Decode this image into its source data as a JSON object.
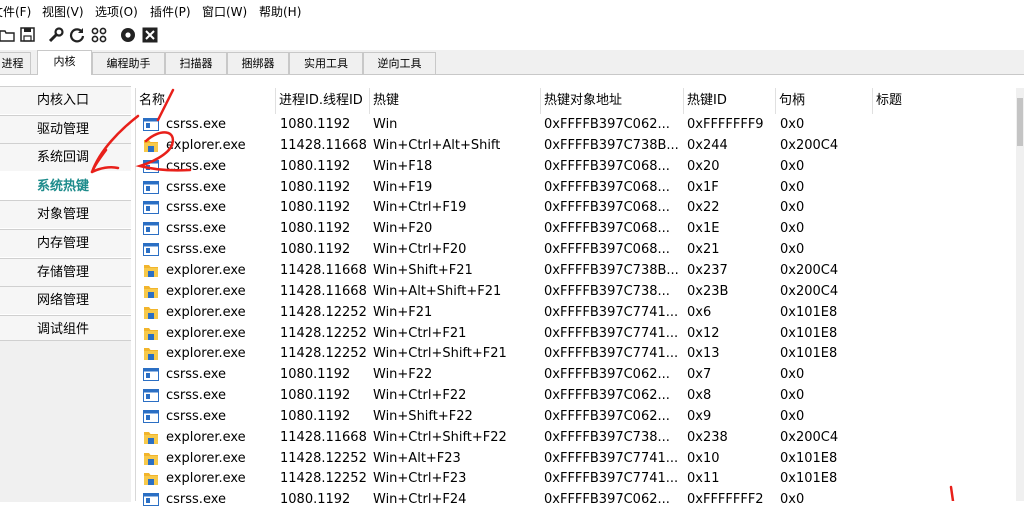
{
  "menu": [
    {
      "label": "文件(F)"
    },
    {
      "label": "视图(V)"
    },
    {
      "label": "选项(O)"
    },
    {
      "label": "插件(P)"
    },
    {
      "label": "窗口(W)"
    },
    {
      "label": "帮助(H)"
    }
  ],
  "toolbar": {
    "icons": [
      "open-folder-icon",
      "save-icon",
      "wrench-icon",
      "refresh-icon",
      "grid-icon",
      "gear-icon",
      "close-icon"
    ]
  },
  "tabs": [
    {
      "label": "进程"
    },
    {
      "label": "内核",
      "active": true
    },
    {
      "label": "编程助手"
    },
    {
      "label": "扫描器"
    },
    {
      "label": "捆绑器"
    },
    {
      "label": "实用工具"
    },
    {
      "label": "逆向工具"
    }
  ],
  "sidebar": {
    "items": [
      {
        "label": "内核入口"
      },
      {
        "label": "驱动管理"
      },
      {
        "label": "系统回调"
      },
      {
        "label": "系统热键",
        "active": true
      },
      {
        "label": "对象管理"
      },
      {
        "label": "内存管理"
      },
      {
        "label": "存储管理"
      },
      {
        "label": "网络管理"
      },
      {
        "label": "调试组件"
      }
    ]
  },
  "table": {
    "columns": [
      "名称",
      "进程ID.线程ID",
      "热键",
      "热键对象地址",
      "热键ID",
      "句柄",
      "标题"
    ],
    "rows": [
      {
        "icon": "csrss",
        "name": "csrss.exe",
        "pid": "1080.1192",
        "hotkey": "Win",
        "addr": "0xFFFFB397C062...",
        "hid": "0xFFFFFFF9",
        "handle": "0x0"
      },
      {
        "icon": "explorer",
        "name": "explorer.exe",
        "pid": "11428.11668",
        "hotkey": "Win+Ctrl+Alt+Shift",
        "addr": "0xFFFFB397C738B...",
        "hid": "0x244",
        "handle": "0x200C4"
      },
      {
        "icon": "csrss",
        "name": "csrss.exe",
        "pid": "1080.1192",
        "hotkey": "Win+F18",
        "addr": "0xFFFFB397C068...",
        "hid": "0x20",
        "handle": "0x0"
      },
      {
        "icon": "csrss",
        "name": "csrss.exe",
        "pid": "1080.1192",
        "hotkey": "Win+F19",
        "addr": "0xFFFFB397C068...",
        "hid": "0x1F",
        "handle": "0x0"
      },
      {
        "icon": "csrss",
        "name": "csrss.exe",
        "pid": "1080.1192",
        "hotkey": "Win+Ctrl+F19",
        "addr": "0xFFFFB397C068...",
        "hid": "0x22",
        "handle": "0x0"
      },
      {
        "icon": "csrss",
        "name": "csrss.exe",
        "pid": "1080.1192",
        "hotkey": "Win+F20",
        "addr": "0xFFFFB397C068...",
        "hid": "0x1E",
        "handle": "0x0"
      },
      {
        "icon": "csrss",
        "name": "csrss.exe",
        "pid": "1080.1192",
        "hotkey": "Win+Ctrl+F20",
        "addr": "0xFFFFB397C068...",
        "hid": "0x21",
        "handle": "0x0"
      },
      {
        "icon": "explorer",
        "name": "explorer.exe",
        "pid": "11428.11668",
        "hotkey": "Win+Shift+F21",
        "addr": "0xFFFFB397C738B...",
        "hid": "0x237",
        "handle": "0x200C4"
      },
      {
        "icon": "explorer",
        "name": "explorer.exe",
        "pid": "11428.11668",
        "hotkey": "Win+Alt+Shift+F21",
        "addr": "0xFFFFB397C738...",
        "hid": "0x23B",
        "handle": "0x200C4"
      },
      {
        "icon": "explorer",
        "name": "explorer.exe",
        "pid": "11428.12252",
        "hotkey": "Win+F21",
        "addr": "0xFFFFB397C7741...",
        "hid": "0x6",
        "handle": "0x101E8"
      },
      {
        "icon": "explorer",
        "name": "explorer.exe",
        "pid": "11428.12252",
        "hotkey": "Win+Ctrl+F21",
        "addr": "0xFFFFB397C7741...",
        "hid": "0x12",
        "handle": "0x101E8"
      },
      {
        "icon": "explorer",
        "name": "explorer.exe",
        "pid": "11428.12252",
        "hotkey": "Win+Ctrl+Shift+F21",
        "addr": "0xFFFFB397C7741...",
        "hid": "0x13",
        "handle": "0x101E8"
      },
      {
        "icon": "csrss",
        "name": "csrss.exe",
        "pid": "1080.1192",
        "hotkey": "Win+F22",
        "addr": "0xFFFFB397C062...",
        "hid": "0x7",
        "handle": "0x0"
      },
      {
        "icon": "csrss",
        "name": "csrss.exe",
        "pid": "1080.1192",
        "hotkey": "Win+Ctrl+F22",
        "addr": "0xFFFFB397C062...",
        "hid": "0x8",
        "handle": "0x0"
      },
      {
        "icon": "csrss",
        "name": "csrss.exe",
        "pid": "1080.1192",
        "hotkey": "Win+Shift+F22",
        "addr": "0xFFFFB397C062...",
        "hid": "0x9",
        "handle": "0x0"
      },
      {
        "icon": "explorer",
        "name": "explorer.exe",
        "pid": "11428.11668",
        "hotkey": "Win+Ctrl+Shift+F22",
        "addr": "0xFFFFB397C738...",
        "hid": "0x238",
        "handle": "0x200C4"
      },
      {
        "icon": "explorer",
        "name": "explorer.exe",
        "pid": "11428.12252",
        "hotkey": "Win+Alt+F23",
        "addr": "0xFFFFB397C7741...",
        "hid": "0x10",
        "handle": "0x101E8"
      },
      {
        "icon": "explorer",
        "name": "explorer.exe",
        "pid": "11428.12252",
        "hotkey": "Win+Ctrl+F23",
        "addr": "0xFFFFB397C7741...",
        "hid": "0x11",
        "handle": "0x101E8"
      },
      {
        "icon": "csrss",
        "name": "csrss.exe",
        "pid": "1080.1192",
        "hotkey": "Win+Ctrl+F24",
        "addr": "0xFFFFB397C062...",
        "hid": "0xFFFFFFF2",
        "handle": "0x0"
      }
    ]
  },
  "colors": {
    "active_sidebar_text": "#1f8c8c",
    "annotation_red": "#e8201a",
    "explorer_icon": "#f2b52c",
    "csrss_icon": "#2b6fc4"
  }
}
